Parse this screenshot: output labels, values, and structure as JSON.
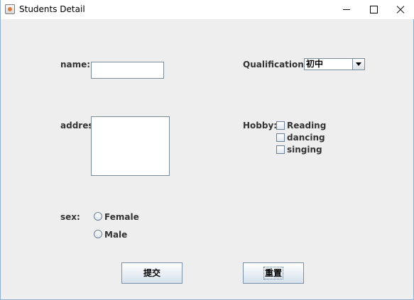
{
  "window": {
    "title": "Students Detail"
  },
  "form": {
    "name_label": "name:",
    "name_value": "",
    "address_label": "address:",
    "address_value": "",
    "qualification_label": "Qualification:",
    "qualification_selected": "初中",
    "hobby_label": "Hobby:",
    "hobbies": [
      {
        "label": "Reading",
        "checked": false
      },
      {
        "label": "dancing",
        "checked": false
      },
      {
        "label": "singing",
        "checked": false
      }
    ],
    "sex_label": "sex:",
    "sex_options": [
      {
        "label": "Female",
        "selected": false
      },
      {
        "label": "Male",
        "selected": false
      }
    ]
  },
  "buttons": {
    "submit_label": "提交",
    "reset_label": "重置"
  },
  "icons": {
    "app": "java-app-icon",
    "minimize": "minimize-icon",
    "maximize": "maximize-icon",
    "close": "close-icon",
    "dropdown": "chevron-down-icon"
  }
}
